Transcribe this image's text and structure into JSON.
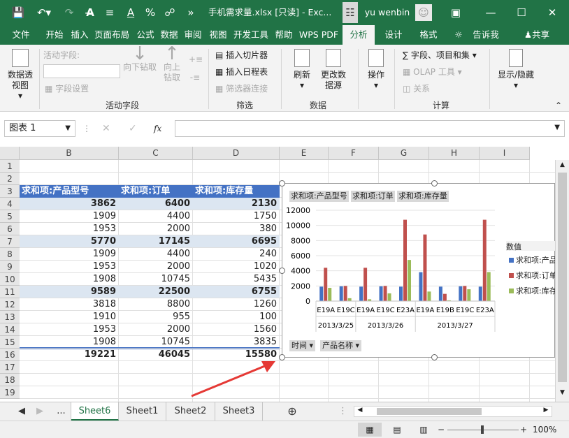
{
  "title_bar": {
    "filename": "手机需求量.xlsx [只读] - Exc...",
    "user": "yu wenbin",
    "save": "保存",
    "undo": "撤销",
    "redo": "恢复"
  },
  "tabs": [
    "文件",
    "开始",
    "插入",
    "页面布局",
    "公式",
    "数据",
    "审阅",
    "视图",
    "开发工具",
    "帮助",
    "WPS PDF",
    "分析",
    "设计",
    "格式"
  ],
  "tell_me": "告诉我",
  "share": "共享",
  "ribbon": {
    "pivot_btn": "数据透视图",
    "active_field_label": "活动字段:",
    "field_settings": "字段设置",
    "drill_down": "向下钻取",
    "drill_up": "向上钻取",
    "group_active_field": "活动字段",
    "insert_slicer": "插入切片器",
    "insert_timeline": "插入日程表",
    "filter_conn": "筛选器连接",
    "group_filter": "筛选",
    "refresh": "刷新",
    "change_source": "更改数据源",
    "group_data": "数据",
    "actions": "操作",
    "fields_items": "字段、项目和集",
    "olap": "OLAP 工具",
    "relations": "关系",
    "group_calc": "计算",
    "show_hide": "显示/隐藏"
  },
  "name_box": "图表 1",
  "formula_fx": "fx",
  "columns": [
    "B",
    "C",
    "D",
    "E",
    "F",
    "G",
    "H",
    "I"
  ],
  "rows": [
    "1",
    "2",
    "3",
    "4",
    "5",
    "6",
    "7",
    "8",
    "9",
    "10",
    "11",
    "12",
    "13",
    "14",
    "15",
    "16",
    "17",
    "18",
    "19"
  ],
  "table_headers": [
    "求和项:产品型号",
    "求和项:订单",
    "求和项:库存量"
  ],
  "table_rows": [
    [
      "3862",
      "6400",
      "2130"
    ],
    [
      "1909",
      "4400",
      "1750"
    ],
    [
      "1953",
      "2000",
      "380"
    ],
    [
      "5770",
      "17145",
      "6695"
    ],
    [
      "1909",
      "4400",
      "240"
    ],
    [
      "1953",
      "2000",
      "1020"
    ],
    [
      "1908",
      "10745",
      "5435"
    ],
    [
      "9589",
      "22500",
      "6755"
    ],
    [
      "3818",
      "8800",
      "1260"
    ],
    [
      "1910",
      "955",
      "100"
    ],
    [
      "1953",
      "2000",
      "1560"
    ],
    [
      "1908",
      "10745",
      "3835"
    ],
    [
      "19221",
      "46045",
      "15580"
    ]
  ],
  "chart_data": {
    "type": "bar",
    "series_buttons": [
      "求和项:产品型号",
      "求和项:订单",
      "求和项:库存量"
    ],
    "categories": [
      "E19A",
      "E19C",
      "E19A",
      "E19C",
      "E23A",
      "E19A",
      "E19B",
      "E19C",
      "E23A"
    ],
    "groups": [
      "2013/3/25",
      "2013/3/26",
      "2013/3/27"
    ],
    "series": [
      {
        "name": "求和项:产品型号",
        "color": "#4472c4",
        "values": [
          1909,
          1953,
          1909,
          1953,
          1908,
          3818,
          1910,
          1953,
          1908
        ]
      },
      {
        "name": "求和项:订单",
        "color": "#c0504d",
        "values": [
          4400,
          2000,
          4400,
          2000,
          10745,
          8800,
          955,
          2000,
          10745
        ]
      },
      {
        "name": "求和项:库存量",
        "color": "#9bbb59",
        "values": [
          1750,
          380,
          240,
          1020,
          5435,
          1260,
          100,
          1560,
          3835
        ]
      }
    ],
    "yticks": [
      "12000",
      "10000",
      "8000",
      "6000",
      "4000",
      "2000",
      "0"
    ],
    "ylim": [
      0,
      12000
    ],
    "legend_title": "数值",
    "legend_items": [
      "求和项:产品",
      "求和项:订单",
      "求和项:库存"
    ],
    "axis_buttons": [
      "时间",
      "产品名称"
    ]
  },
  "sheets": [
    "Sheet6",
    "Sheet1",
    "Sheet2",
    "Sheet3"
  ],
  "sheet_more": "...",
  "zoom": "100%"
}
